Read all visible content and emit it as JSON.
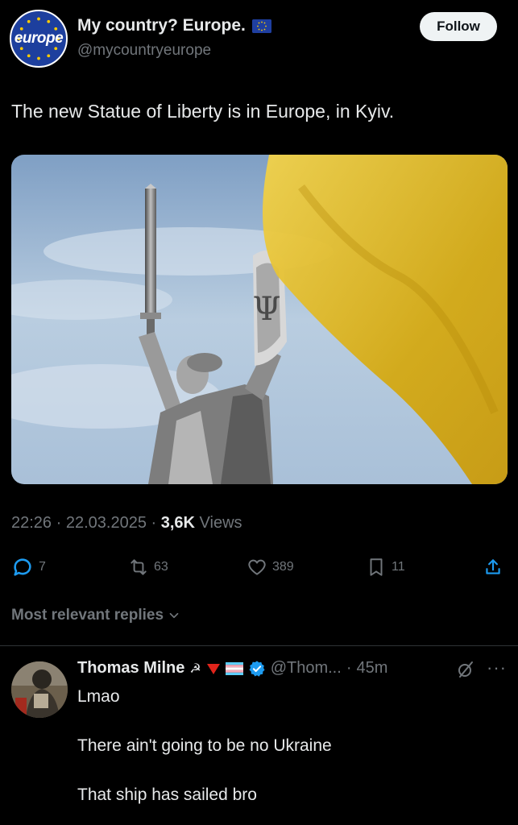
{
  "account": {
    "display_name": "My country? Europe.",
    "handle": "@mycountryeurope",
    "avatar_text": "europe",
    "follow_label": "Follow"
  },
  "tweet": {
    "text": "The new Statue of Liberty is in Europe, in Kyiv.",
    "time": "22:26",
    "date": "22.03.2025",
    "views_count": "3,6K",
    "views_label": "Views"
  },
  "actions": {
    "replies": "7",
    "reposts": "63",
    "likes": "389",
    "bookmarks": "11"
  },
  "replies_section": {
    "sort_label": "Most relevant replies"
  },
  "reply": {
    "name": "Thomas Milne",
    "name_emoji": "☭",
    "handle": "@Thom...",
    "separator": "·",
    "time": "45m",
    "lines": [
      "Lmao",
      "There ain't going to be no Ukraine",
      "That ship has sailed bro"
    ]
  },
  "icons": {
    "reply": "comment-icon",
    "repost": "repost-icon",
    "like": "heart-icon",
    "bookmark": "bookmark-icon",
    "share": "share-icon",
    "verified": "verified-badge-icon",
    "grok": "grok-icon",
    "more": "more-icon"
  },
  "colors": {
    "background": "#000000",
    "text": "#e7e9ea",
    "muted": "#71767b",
    "verified": "#1d9bf0",
    "flag_blue": "#2f5fbf",
    "flag_yellow": "#e8c21a"
  }
}
